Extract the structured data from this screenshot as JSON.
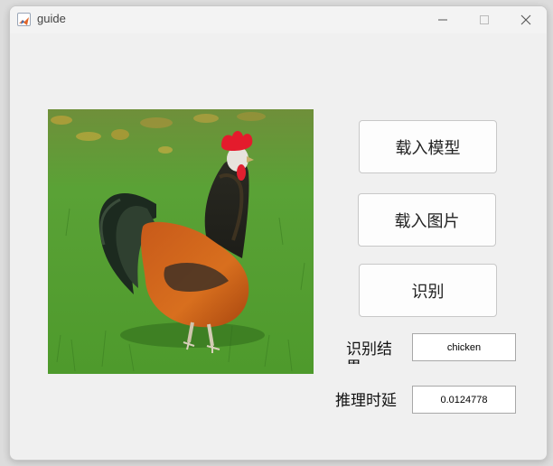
{
  "window": {
    "title": "guide",
    "controls": [
      "minimize-icon",
      "maximize-icon",
      "close-icon"
    ]
  },
  "image": {
    "subject_icon": "rooster-photo"
  },
  "buttons": {
    "load_model": "载入模型",
    "load_image": "载入图片",
    "recognize": "识别"
  },
  "result": {
    "label": "识别结果",
    "value": "chicken"
  },
  "latency": {
    "label": "推理时延",
    "value": "0.0124778"
  },
  "colors": {
    "window_bg": "#f0f0f0",
    "field_bg": "#ffffff",
    "button_bg": "#fdfdfd"
  }
}
